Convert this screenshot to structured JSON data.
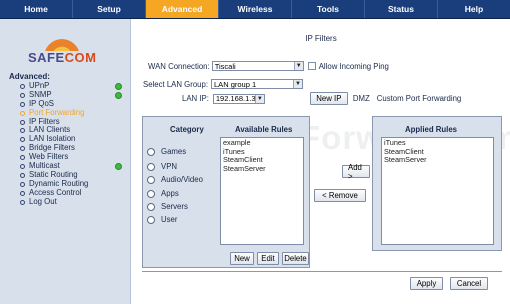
{
  "nav": {
    "tabs": [
      "Home",
      "Setup",
      "Advanced",
      "Wireless",
      "Tools",
      "Status",
      "Help"
    ],
    "active": "Advanced"
  },
  "brand": {
    "logo_text_a": "SAFE",
    "logo_text_b": "COM"
  },
  "sidebar": {
    "heading": "Advanced:",
    "items": [
      {
        "label": "UPnP",
        "status": true
      },
      {
        "label": "SNMP",
        "status": true
      },
      {
        "label": "IP QoS",
        "status": false
      },
      {
        "label": "Port Forwarding",
        "status": false,
        "active": true
      },
      {
        "label": "IP Filters",
        "status": false
      },
      {
        "label": "LAN Clients",
        "status": false
      },
      {
        "label": "LAN Isolation",
        "status": false
      },
      {
        "label": "Bridge Filters",
        "status": false
      },
      {
        "label": "Web Filters",
        "status": false
      },
      {
        "label": "Multicast",
        "status": true
      },
      {
        "label": "Static Routing",
        "status": false
      },
      {
        "label": "Dynamic Routing",
        "status": false
      },
      {
        "label": "Access Control",
        "status": false
      },
      {
        "label": "Log Out",
        "status": false
      }
    ]
  },
  "main": {
    "title": "IP Filters",
    "wan_label": "WAN Connection:",
    "wan_value": "Tiscali",
    "allow_ping_label": "Allow Incoming Ping",
    "lan_group_label": "Select LAN Group:",
    "lan_group_value": "LAN group 1",
    "lan_ip_label": "LAN IP:",
    "lan_ip_value": "192.168.1.3",
    "new_ip_button": "New IP",
    "dmz_link": "DMZ",
    "custom_link": "Custom Port Forwarding",
    "category_title": "Category",
    "categories": [
      "Games",
      "VPN",
      "Audio/Video",
      "Apps",
      "Servers",
      "User"
    ],
    "available_title": "Available Rules",
    "available_rules": [
      "example",
      "iTunes",
      "SteamClient",
      "SteamServer"
    ],
    "applied_title": "Applied Rules",
    "applied_rules": [
      "iTunes",
      "SteamClient",
      "SteamServer"
    ],
    "add_button": "Add >",
    "remove_button": "< Remove",
    "new_button": "New",
    "edit_button": "Edit",
    "delete_button": "Delete",
    "apply_button": "Apply",
    "cancel_button": "Cancel",
    "watermark": "PortForward.com"
  },
  "colors": {
    "nav_bg": "#1a3d7c",
    "nav_active": "#f5a623",
    "panel_bg": "#d8e0ec",
    "status_green": "#3dbb3d"
  }
}
